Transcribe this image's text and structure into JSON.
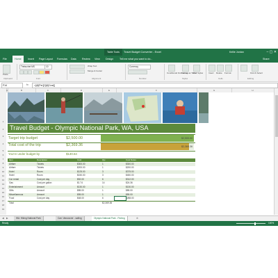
{
  "window": {
    "contextual_tab": "Table Tools",
    "title": "Travel Budget Converter - Excel",
    "user": "Kellie Jordan",
    "controls": "–  ▢  ✕"
  },
  "ribbon_tabs": [
    "File",
    "Home",
    "Insert",
    "Page Layout",
    "Formulas",
    "Data",
    "Review",
    "View",
    "Design"
  ],
  "tell_me": "Tell me what you want to do...",
  "share": "Share",
  "ribbon": {
    "paste": "Paste",
    "font_name": "Trebuchet MS",
    "font_size": "10",
    "wrap_text": "Wrap Text",
    "merge_center": "Merge & Center",
    "number_format": "Currency",
    "conditional_formatting": "Conditional Formatting",
    "format_as_table": "Format as Table",
    "cell_styles": "Cell Styles",
    "insert": "Insert",
    "delete": "Delete",
    "format": "Format",
    "find_select": "Find & Select",
    "groups": [
      "Clipboard",
      "Font",
      "Alignment",
      "Number",
      "Styles",
      "Cells",
      "Editing"
    ]
  },
  "formula_bar": {
    "name_box": "F14",
    "fx": "fx",
    "formula": "=[@[Per]]*[@[Cost]]"
  },
  "columns": [
    "A",
    "B",
    "C",
    "D",
    "E",
    "F",
    "G",
    "H"
  ],
  "banner": {
    "title": "Travel Budget - Olympic National Park, WA, USA"
  },
  "target": {
    "label": "Target trip budget",
    "value": "$2,500.00",
    "bar_value": "$2,500.00",
    "fill": 1.0
  },
  "total": {
    "label": "Total cost of the trip",
    "value": "$2,369.36",
    "bar_value": "$2,369.36",
    "fill": 0.948
  },
  "under": {
    "label": "You're under budget by",
    "value": "$130.64"
  },
  "table": {
    "headers": [
      "Item",
      "Description",
      "Cost",
      "Qty",
      "Cost Notes"
    ],
    "rows": [
      [
        "Airfare",
        "Tickets",
        "$300.00",
        "1",
        "$300.00"
      ],
      [
        "Airfare",
        "Tickets",
        "$200.00",
        "1",
        "$200.00"
      ],
      [
        "Hotel",
        "Room",
        "$125.00",
        "3",
        "$375.00"
      ],
      [
        "Hotel",
        "Room",
        "$150.00",
        "3",
        "$450.00"
      ],
      [
        "Car rental",
        "Cost per day",
        "$52.00",
        "6",
        "$312.00"
      ],
      [
        "Gas",
        "Cost per gallon",
        "$1.74",
        "14",
        "$24.36"
      ],
      [
        "Entertainment",
        "Amount",
        "$130.00",
        "1",
        "$130.00"
      ],
      [
        "Gifts",
        "Amount",
        "$85.00",
        "1",
        "$85.00"
      ],
      [
        "Miscellaneous",
        "Amount",
        "$55.00",
        "1",
        "$55.00"
      ],
      [
        "Food",
        "Cost per day",
        "$48.00",
        "6",
        "$288.00"
      ]
    ],
    "total_label": "Total",
    "total_value": "$2,369.36"
  },
  "sheets": [
    "WA: Hiking National Park",
    "Can: Vancouver - sailing",
    "Olympic National Park - Fishing"
  ],
  "active_sheet": 2,
  "status": {
    "ready": "Ready",
    "zoom": "100%"
  },
  "colors": {
    "excel_green": "#217346",
    "theme_green": "#5c8a3c",
    "target_bar": "#7fb14f",
    "total_bar": "#c8a23a"
  }
}
